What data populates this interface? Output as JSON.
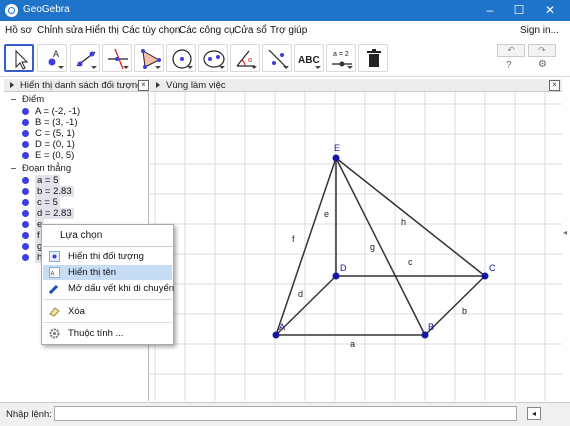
{
  "window": {
    "title": "GeoGebra",
    "minimize": "–",
    "maximize": "☐",
    "close": "✕"
  },
  "menubar": {
    "items": [
      "Hồ sơ",
      "Chỉnh sửa",
      "Hiển thị",
      "Các tùy chọn",
      "Các công cụ",
      "Cửa sổ",
      "Trợ giúp"
    ],
    "sign_in": "Sign in..."
  },
  "toolbar": {
    "tools": [
      "move-tool",
      "point-tool",
      "line-tool",
      "perpendicular-tool",
      "polygon-tool",
      "circle-tool",
      "ellipse-tool",
      "angle-tool",
      "reflect-tool",
      "text-tool",
      "slider-tool",
      "delete-tool"
    ],
    "text_tool_label": "ABC",
    "slider_tool_label": "a = 2",
    "undo": "↶",
    "redo": "↷",
    "help": "?",
    "settings": "⚙"
  },
  "algebra": {
    "header": "Hiển thị danh sách đối tượng",
    "points_label": "Điểm",
    "points": [
      "A = (-2, -1)",
      "B = (3, -1)",
      "C = (5, 1)",
      "D = (0, 1)",
      "E = (0, 5)"
    ],
    "segments_label": "Đoạn thẳng",
    "segments": [
      "a = 5",
      "b = 2.83",
      "c = 5",
      "d = 2.83",
      "e",
      "f",
      "g",
      "h"
    ]
  },
  "graphics": {
    "header": "Vùng làm việc",
    "point_labels": [
      "A",
      "B",
      "C",
      "D",
      "E"
    ],
    "segment_labels": [
      "a",
      "b",
      "c",
      "d",
      "e",
      "f",
      "g",
      "h"
    ]
  },
  "context_menu": {
    "title": "Lựa chọn",
    "items": [
      "Hiển thị đối tượng",
      "Hiển thị tên",
      "Mở dấu vết khi di chuyển",
      "Xóa",
      "Thuộc tính ..."
    ],
    "highlighted_index": 1
  },
  "input_bar": {
    "label": "Nhập lệnh:",
    "value": ""
  },
  "colors": {
    "titlebar": "#1f74c9",
    "point": "#1515a8",
    "segment": "#333333",
    "highlight": "#c6ddf5"
  }
}
